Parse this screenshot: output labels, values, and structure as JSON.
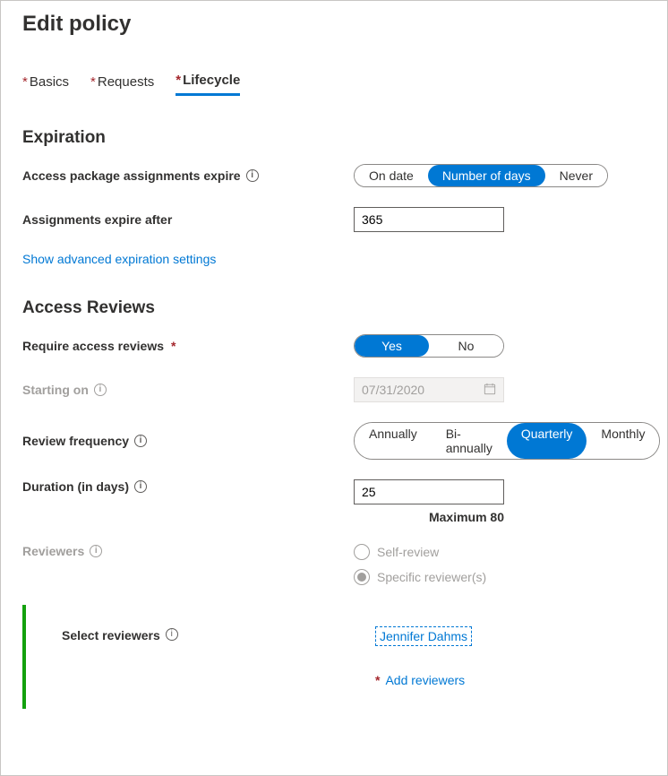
{
  "page_title": "Edit policy",
  "tabs": [
    {
      "label": "Basics",
      "required": true,
      "active": false
    },
    {
      "label": "Requests",
      "required": true,
      "active": false
    },
    {
      "label": "Lifecycle",
      "required": true,
      "active": true
    }
  ],
  "expiration": {
    "header": "Expiration",
    "assignments_expire_label": "Access package assignments expire",
    "expire_mode_options": [
      "On date",
      "Number of days",
      "Never"
    ],
    "expire_mode_selected": "Number of days",
    "expire_after_label": "Assignments expire after",
    "expire_after_value": "365",
    "advanced_link": "Show advanced expiration settings"
  },
  "access_reviews": {
    "header": "Access Reviews",
    "require_label": "Require access reviews",
    "require_options": [
      "Yes",
      "No"
    ],
    "require_selected": "Yes",
    "starting_on_label": "Starting on",
    "starting_on_value": "07/31/2020",
    "frequency_label": "Review frequency",
    "frequency_options": [
      "Annually",
      "Bi-annually",
      "Quarterly",
      "Monthly"
    ],
    "frequency_selected": "Quarterly",
    "duration_label": "Duration (in days)",
    "duration_value": "25",
    "duration_hint": "Maximum 80",
    "reviewers_label": "Reviewers",
    "reviewers_options": [
      "Self-review",
      "Specific reviewer(s)"
    ],
    "reviewers_selected": "Specific reviewer(s)",
    "select_reviewers_label": "Select reviewers",
    "selected_reviewer": "Jennifer Dahms",
    "add_reviewers_label": "Add reviewers"
  }
}
